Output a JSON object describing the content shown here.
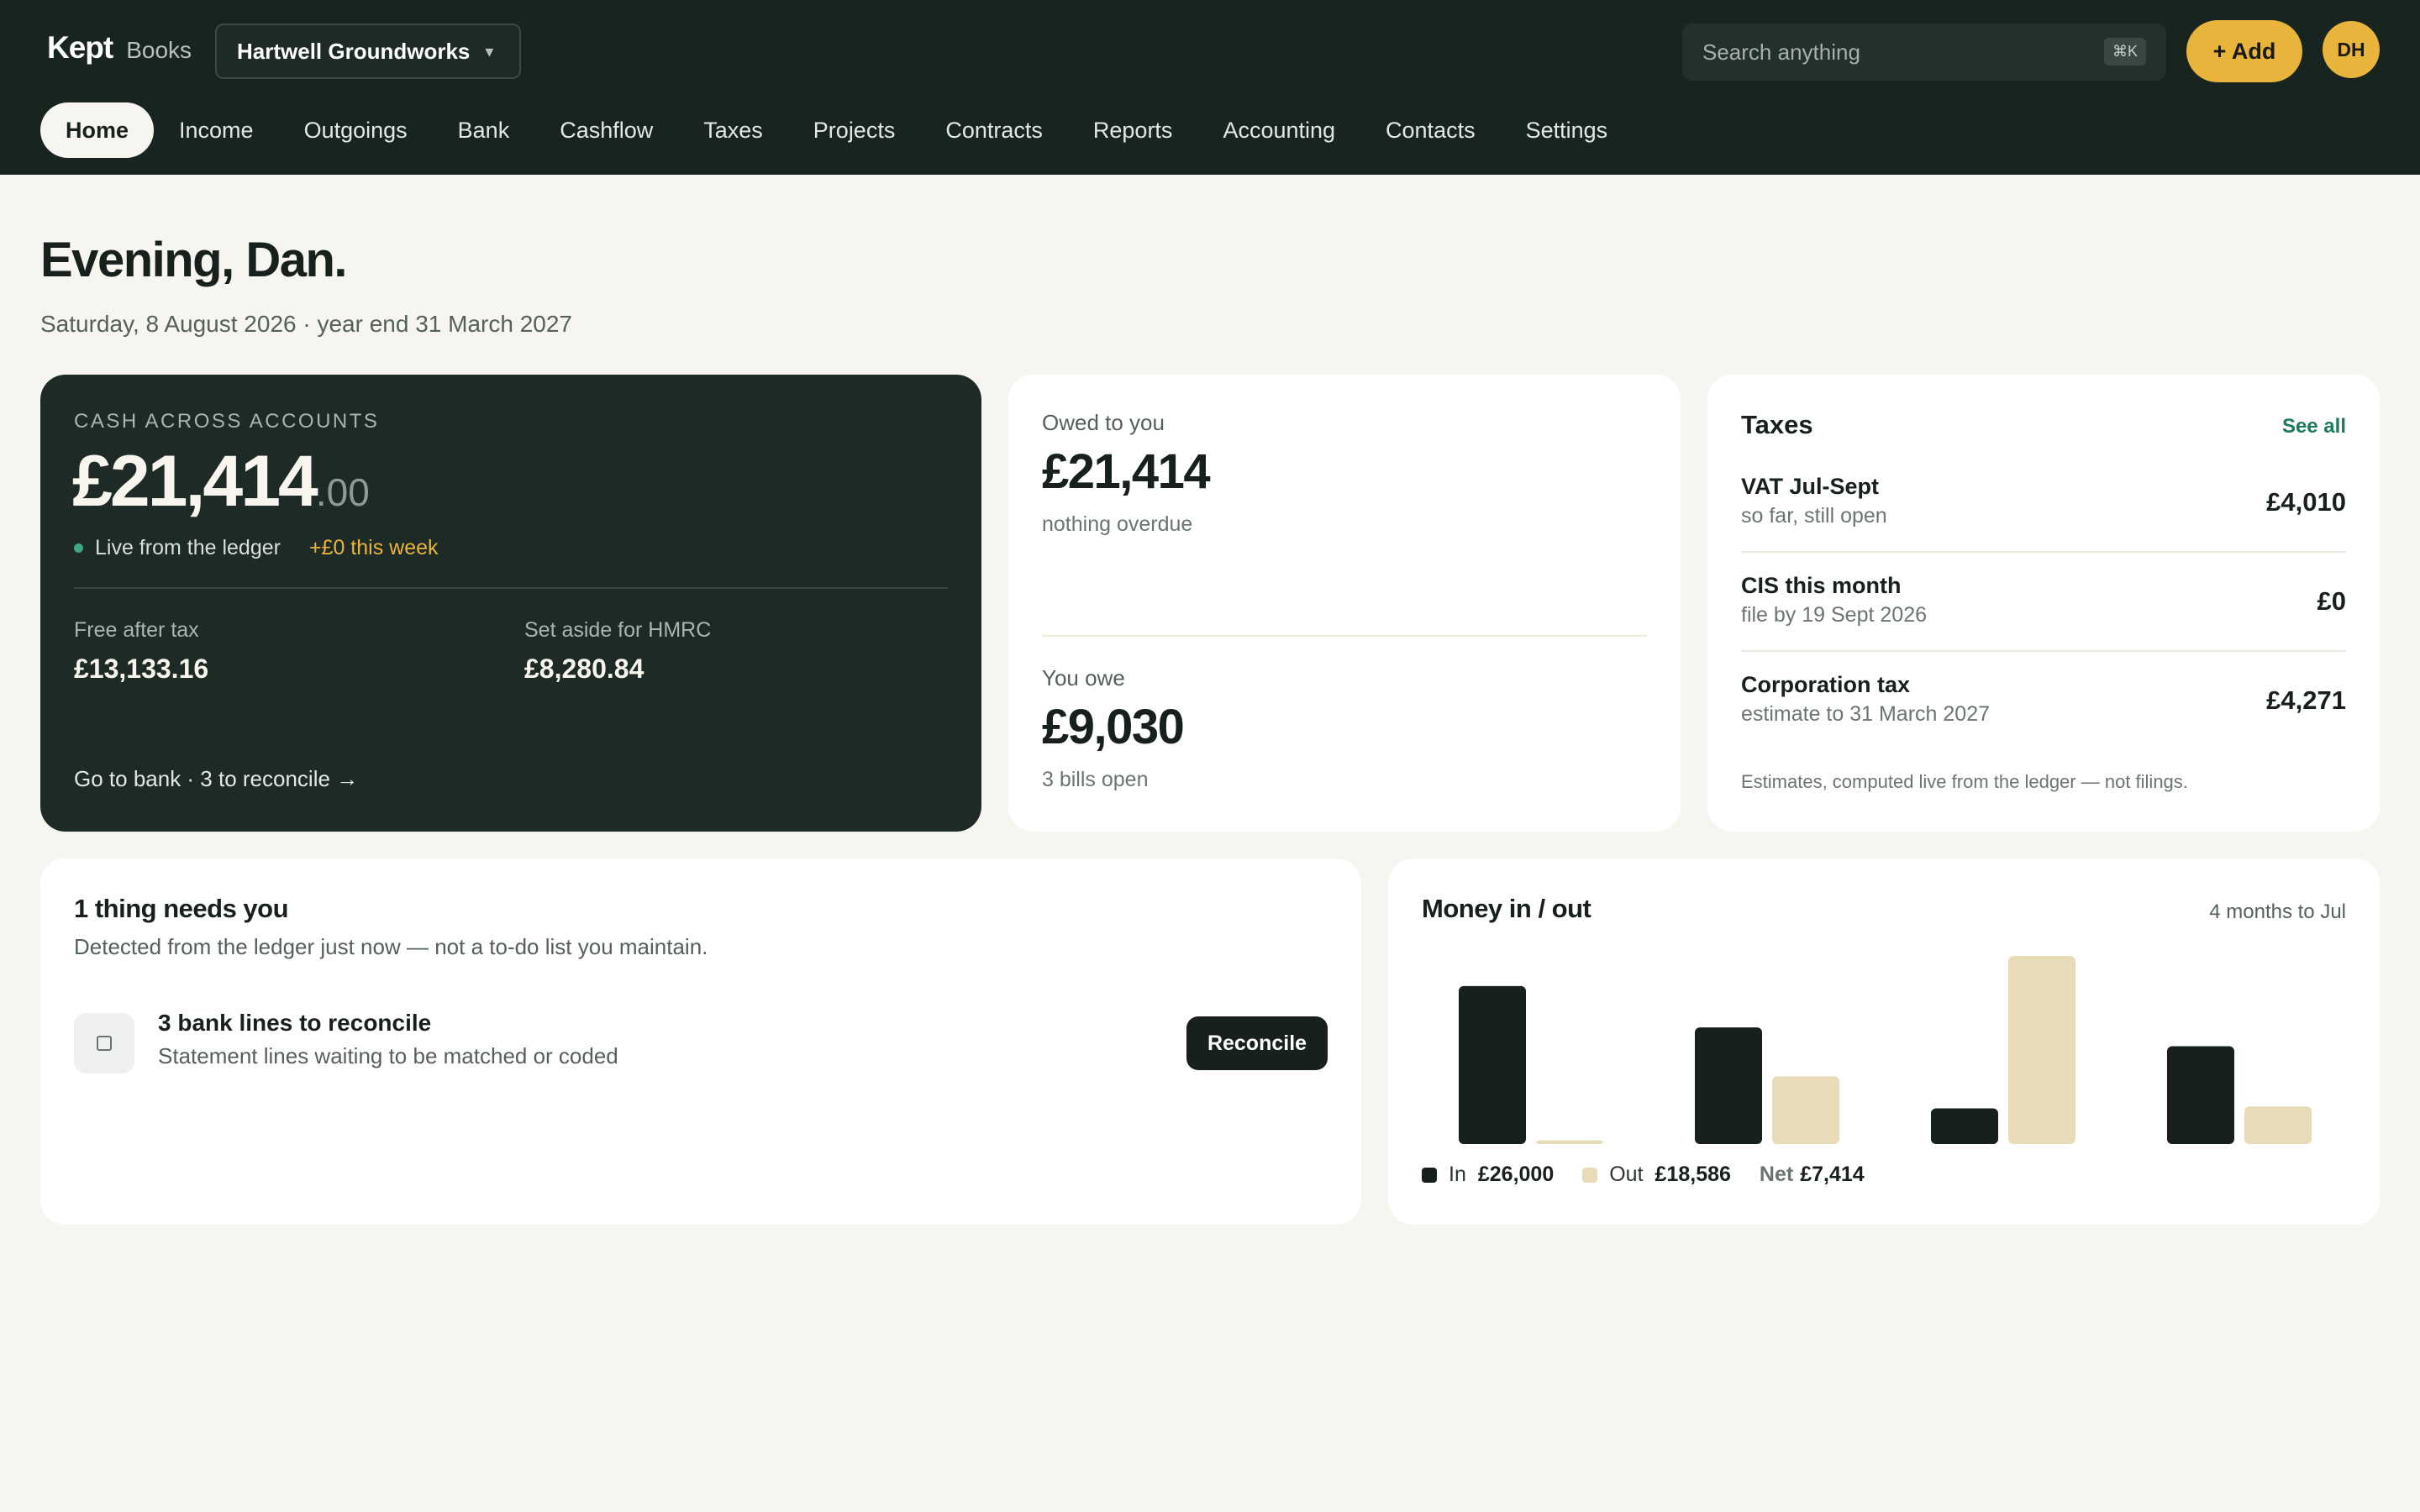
{
  "brand": {
    "name": "Kept",
    "sub": "Books"
  },
  "company": {
    "name": "Hartwell Groundworks",
    "caret": "▾"
  },
  "search": {
    "placeholder": "Search anything",
    "shortcut": "⌘K"
  },
  "actions": {
    "add_label": "+ Add",
    "avatar_initials": "DH"
  },
  "nav": {
    "items": [
      "Home",
      "Income",
      "Outgoings",
      "Bank",
      "Cashflow",
      "Taxes",
      "Projects",
      "Contracts",
      "Reports",
      "Accounting",
      "Contacts",
      "Settings"
    ],
    "active": "Home"
  },
  "greeting": {
    "title": "Evening, Dan.",
    "subtitle": "Saturday, 8 August 2026 · year end 31 March 2027"
  },
  "cash": {
    "label": "CASH ACROSS ACCOUNTS",
    "amount_whole": "£21,414",
    "amount_dec": ".00",
    "live_text": "Live from the ledger",
    "week_change": "+£0 this week",
    "free_label": "Free after tax",
    "free_value": "£13,133.16",
    "aside_label": "Set aside for HMRC",
    "aside_value": "£8,280.84",
    "link": "Go to bank · 3 to reconcile →"
  },
  "owed": {
    "to_you_label": "Owed to you",
    "to_you_value": "£21,414",
    "to_you_note": "nothing overdue",
    "you_owe_label": "You owe",
    "you_owe_value": "£9,030",
    "you_owe_note": "3 bills open"
  },
  "taxes": {
    "title": "Taxes",
    "see_all": "See all",
    "rows": [
      {
        "name": "VAT Jul-Sept",
        "desc": "so far, still open",
        "amount": "£4,010"
      },
      {
        "name": "CIS this month",
        "desc": "file by 19 Sept 2026",
        "amount": "£0"
      },
      {
        "name": "Corporation tax",
        "desc": "estimate to 31 March 2027",
        "amount": "£4,271"
      }
    ],
    "footnote": "Estimates, computed live from the ledger — not filings."
  },
  "needs": {
    "title": "1 thing needs you",
    "subtitle": "Detected from the ledger just now — not a to-do list you maintain.",
    "item_title": "3 bank lines to reconcile",
    "item_sub": "Statement lines waiting to be matched or coded",
    "button": "Reconcile"
  },
  "money": {
    "title": "Money in / out",
    "range": "4 months to Jul",
    "legend": {
      "in_label": "In",
      "in_value": "£26,000",
      "out_label": "Out",
      "out_value": "£18,586",
      "net_label": "Net",
      "net_value": "£7,414"
    },
    "colors": {
      "in": "#17201c",
      "out": "#e8dbb8"
    }
  },
  "chart_data": {
    "type": "bar",
    "categories": [
      "",
      "",
      "",
      ""
    ],
    "series": [
      {
        "name": "In",
        "values": [
          8400,
          6200,
          1900,
          5200
        ]
      },
      {
        "name": "Out",
        "values": [
          200,
          3600,
          10000,
          2000
        ]
      }
    ],
    "ylim": [
      0,
      10000
    ],
    "grid": false,
    "legend": "bottom-left"
  }
}
